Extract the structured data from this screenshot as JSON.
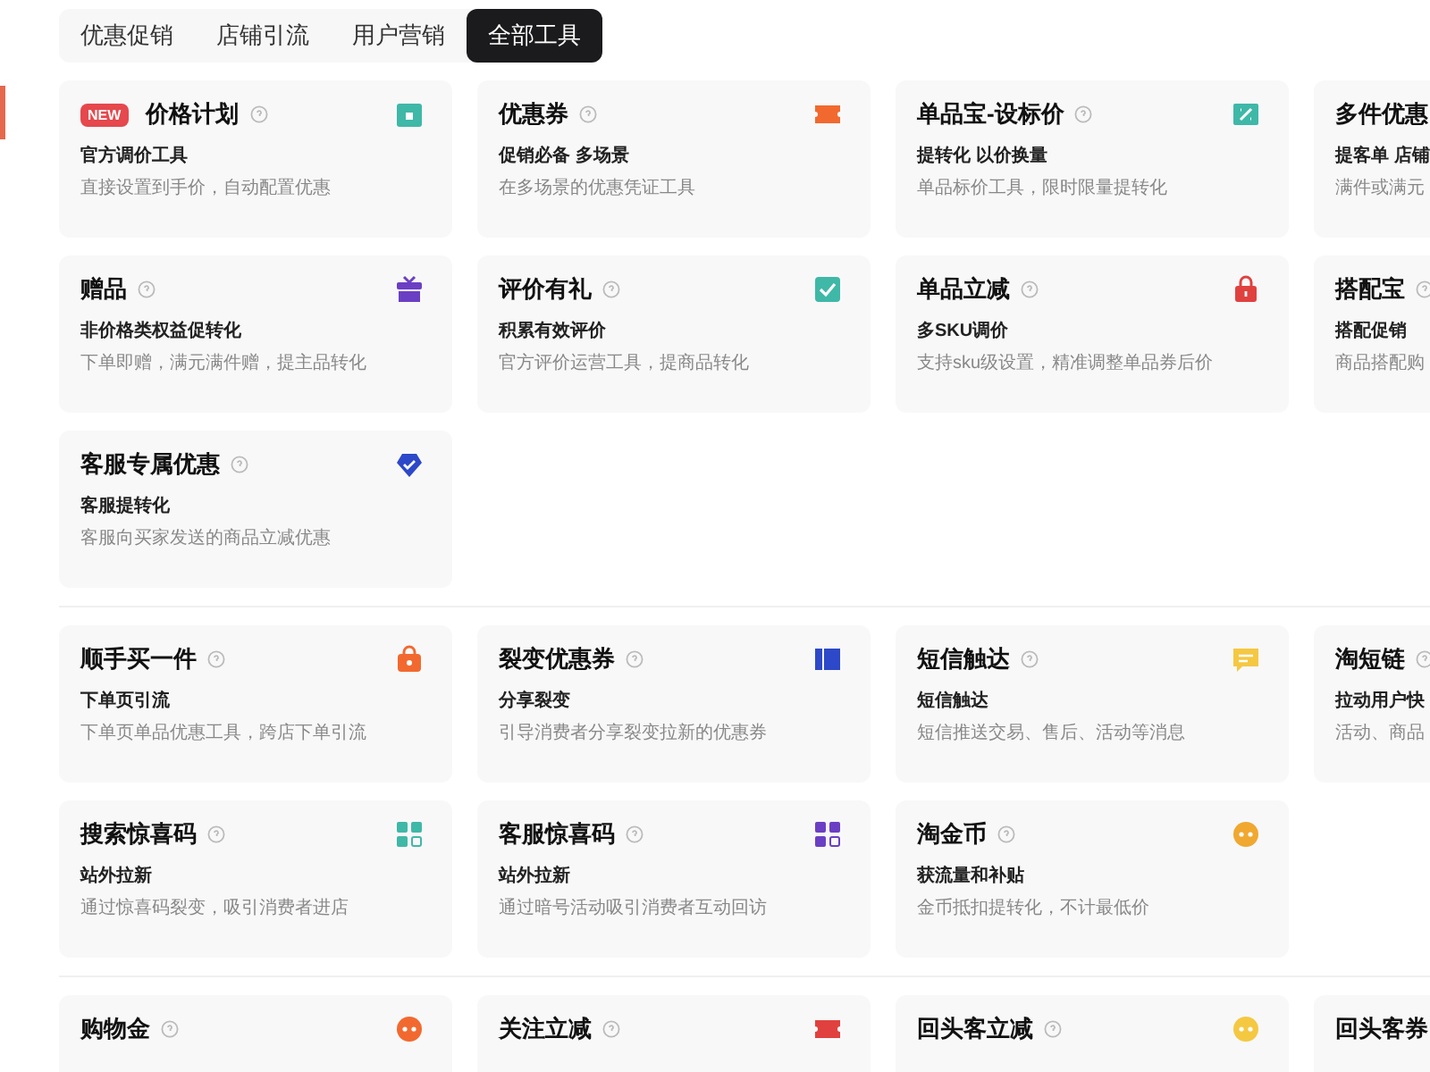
{
  "tabs": [
    {
      "label": "优惠促销",
      "selected": false
    },
    {
      "label": "店铺引流",
      "selected": false
    },
    {
      "label": "用户营销",
      "selected": false
    },
    {
      "label": "全部工具",
      "selected": true
    }
  ],
  "sections": [
    {
      "cards": [
        {
          "badge": "NEW",
          "title": "价格计划",
          "subtitle": "官方调价工具",
          "description": "直接设置到手价，自动配置优惠",
          "kind": "calendar",
          "color": "#3fb8a8"
        },
        {
          "title": "优惠券",
          "subtitle": "促销必备 多场景",
          "description": "在多场景的优惠凭证工具",
          "kind": "ticket",
          "color": "#f2692f"
        },
        {
          "title": "单品宝-设标价",
          "subtitle": "提转化 以价换量",
          "description": "单品标价工具，限时限量提转化",
          "kind": "percent",
          "color": "#3fb8a8"
        },
        {
          "title": "多件优惠",
          "subtitle": "提客单 店铺",
          "description": "满件或满元"
        },
        {
          "title": "赠品",
          "subtitle": "非价格类权益促转化",
          "description": "下单即赠，满元满件赠，提主品转化",
          "kind": "gift",
          "color": "#6b3fc4"
        },
        {
          "title": "评价有礼",
          "subtitle": "积累有效评价",
          "description": "官方评价运营工具，提商品转化",
          "kind": "check",
          "color": "#3fb8a8"
        },
        {
          "title": "单品立减",
          "subtitle": "多SKU调价",
          "description": "支持sku级设置，精准调整单品券后价",
          "kind": "lock",
          "color": "#e0413f"
        },
        {
          "title": "搭配宝",
          "subtitle": "搭配促销",
          "description": "商品搭配购"
        },
        {
          "title": "客服专属优惠",
          "subtitle": "客服提转化",
          "description": "客服向买家发送的商品立减优惠",
          "kind": "diamond",
          "color": "#2d48c8"
        }
      ]
    },
    {
      "cards": [
        {
          "title": "顺手买一件",
          "subtitle": "下单页引流",
          "description": "下单页单品优惠工具，跨店下单引流",
          "kind": "bag",
          "color": "#f2692f"
        },
        {
          "title": "裂变优惠券",
          "subtitle": "分享裂变",
          "description": "引导消费者分享裂变拉新的优惠券",
          "kind": "panel",
          "color": "#2d48c8"
        },
        {
          "title": "短信触达",
          "subtitle": "短信触达",
          "description": "短信推送交易、售后、活动等消息",
          "kind": "message",
          "color": "#f5c842"
        },
        {
          "title": "淘短链",
          "subtitle": "拉动用户快",
          "description": "活动、商品"
        },
        {
          "title": "搜索惊喜码",
          "subtitle": "站外拉新",
          "description": "通过惊喜码裂变，吸引消费者进店",
          "kind": "grid",
          "color": "#3fb8a8"
        },
        {
          "title": "客服惊喜码",
          "subtitle": "站外拉新",
          "description": "通过暗号活动吸引消费者互动回访",
          "kind": "grid",
          "color": "#6b3fc4"
        },
        {
          "title": "淘金币",
          "subtitle": "获流量和补贴",
          "description": "金币抵扣提转化，不计最低价",
          "kind": "coin",
          "color": "#f0a830"
        }
      ]
    },
    {
      "cards": [
        {
          "title": "购物金",
          "kind": "coin",
          "color": "#f2692f"
        },
        {
          "title": "关注立减",
          "kind": "ticket",
          "color": "#e0413f"
        },
        {
          "title": "回头客立减",
          "kind": "coin",
          "color": "#f5c842"
        },
        {
          "title": "回头客券"
        }
      ]
    }
  ]
}
